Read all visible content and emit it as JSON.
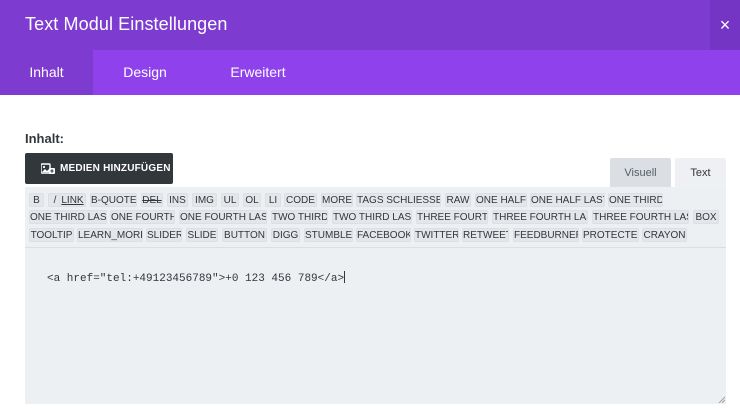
{
  "header": {
    "title": "Text Modul Einstellungen",
    "close_icon": "×",
    "bg_color": "#7e3bd0"
  },
  "tabs": [
    {
      "label": "Inhalt",
      "active": true
    },
    {
      "label": "Design",
      "active": false
    },
    {
      "label": "Erweitert",
      "active": false
    }
  ],
  "content": {
    "label": "Inhalt:",
    "media_button": "MEDIEN HINZUFÜGEN",
    "media_icon": "media-add-icon",
    "editor_tabs": [
      {
        "label": "Visuell",
        "active": false
      },
      {
        "label": "Text",
        "active": true
      }
    ],
    "quicktags": [
      [
        "B",
        "/",
        "LINK",
        "B-QUOTE",
        "DEL",
        "INS",
        "IMG",
        "UL",
        "OL",
        "LI",
        "CODE",
        "MORE",
        "TAGS SCHLIESSEN",
        "RAW",
        "ONE HALF",
        "ONE HALF LAST",
        "ONE THIRD"
      ],
      [
        "ONE THIRD LAST",
        "ONE FOURTH",
        "ONE FOURTH LAST",
        "TWO THIRD",
        "TWO THIRD LAST",
        "THREE FOURTH",
        "THREE FOURTH LAST",
        "THREE FOURTH LAST",
        "BOX"
      ],
      [
        "TOOLTIP",
        "LEARN_MORE",
        "SLIDER",
        "SLIDE",
        "BUTTON",
        "DIGG",
        "STUMBLE",
        "FACEBOOK",
        "TWITTER",
        "RETWEET",
        "FEEDBURNER",
        "PROTECTED",
        "CRAYON"
      ]
    ],
    "editor_value": "<a href=\"tel:+49123456789\">+0 123 456 789</a>"
  },
  "colors": {
    "accent": "#8f42ec",
    "accent_dark": "#7e3bd0",
    "button_dark": "#32373c"
  }
}
